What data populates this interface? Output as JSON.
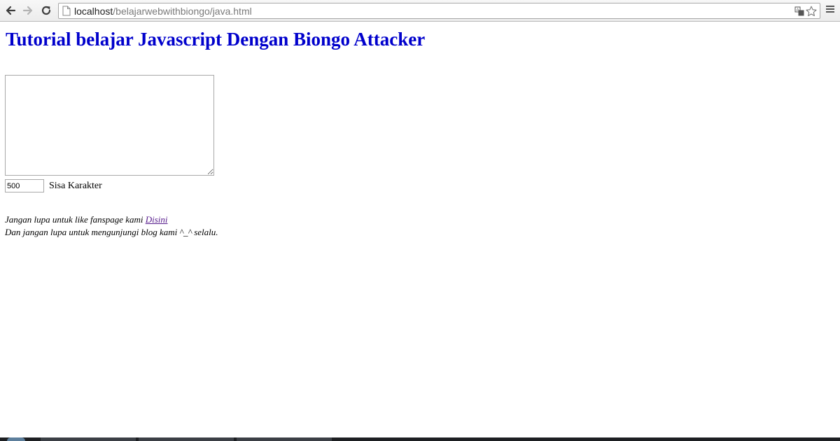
{
  "browser": {
    "url_host": "localhost",
    "url_path": "/belajarwebwithbiongo/java.html",
    "icons": {
      "back": "back-arrow-icon",
      "forward": "forward-arrow-icon",
      "reload": "reload-icon",
      "page": "page-document-icon",
      "translate": "translate-icon",
      "bookmark": "star-icon",
      "menu": "hamburger-menu-icon"
    }
  },
  "page": {
    "title": "Tutorial belajar Javascript Dengan Biongo Attacker",
    "title_color": "#0000cc",
    "textarea_value": "",
    "counter_value": "500",
    "counter_label": "Sisa Karakter",
    "note1_text": "Jangan lupa untuk like fanspage kami ",
    "note1_link": "Disini ",
    "note2_text": "Dan jangan lupa untuk mengunjungi blog kami ^_^ selalu."
  }
}
